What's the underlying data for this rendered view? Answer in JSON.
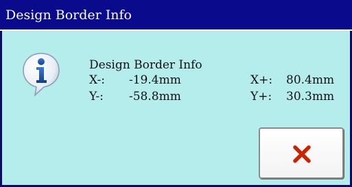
{
  "window": {
    "title": "Design Border Info"
  },
  "message": {
    "heading": "Design Border Info",
    "x_minus_label": "X-:",
    "x_minus_value": "-19.4mm",
    "y_minus_label": "Y-:",
    "y_minus_value": "-58.8mm",
    "x_plus_label": "X+:",
    "x_plus_value": "80.4mm",
    "y_plus_label": "Y+:",
    "y_plus_value": "30.3mm"
  },
  "icons": {
    "info": "info-icon",
    "close": "close-icon"
  },
  "colors": {
    "titlebar": "#0a0a8c",
    "background": "#b5ecec",
    "close_icon": "#cc2200",
    "info_icon": "#1a4fa8"
  }
}
